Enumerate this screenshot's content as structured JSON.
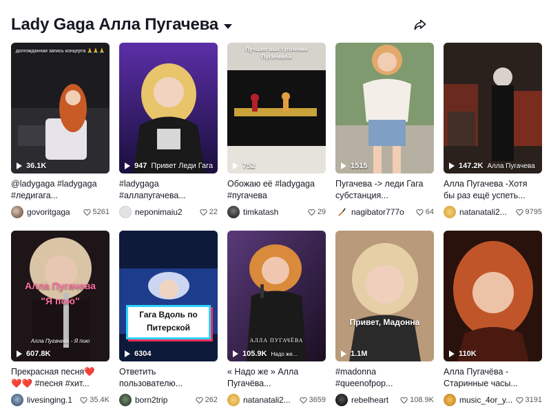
{
  "header": {
    "title": "Lady Gaga Алла Пугачева"
  },
  "videos": [
    {
      "views": "36.1K",
      "overlay": "долгожданная запись концерта 🙏🙏🙏",
      "caption_line1": "@ladygaga #ladygaga",
      "caption_line2": "#ледигага...",
      "author": "govoritgaga",
      "likes": "5261",
      "colors": {
        "bg": "#2b2a2e",
        "accent": "#c85a26"
      }
    },
    {
      "views": "947",
      "overlay": "Привет Леди Гага",
      "caption_line1": "#ladygaga",
      "caption_line2": "#аллапугачева...",
      "author": "neponimaiu2",
      "likes": "22",
      "colors": {
        "bg": "#3a1f7a",
        "accent": "#e8c46a"
      }
    },
    {
      "views": "752",
      "overlay": "Лучшее выступление Пугачевой",
      "caption_line1": "Обожаю её #ladygaga",
      "caption_line2": "#пугачева",
      "author": "timkatash",
      "likes": "29",
      "colors": {
        "bg": "#c9c6bf",
        "accent": "#b3202a"
      }
    },
    {
      "views": "1515",
      "overlay": "",
      "caption_line1": "Пугачева -> леди Гага",
      "caption_line2": "субстанция...",
      "author": "nagibator777o",
      "likes": "64",
      "colors": {
        "bg": "#8aa37a",
        "accent": "#e3a86b"
      }
    },
    {
      "views": "147.2K",
      "overlay": "Алла Пугачева",
      "caption_line1": "Алла Пугачева -Хотя",
      "caption_line2": "бы раз ещё успеть...",
      "author": "natanatali2...",
      "likes": "9795",
      "colors": {
        "bg": "#4a3a33",
        "accent": "#c53a2a"
      }
    },
    {
      "views": "607.8K",
      "overlay": "Алла Пугачева",
      "overlay2": "\"Я пою\"",
      "overlay3": "Алла Пугачева - Я пою",
      "caption_line1": "Прекрасная песня❤️",
      "caption_line2": "❤️❤️ #песня #хит...",
      "author": "livesinging.1",
      "likes": "35.4K",
      "colors": {
        "bg": "#2a1c22",
        "accent": "#ff5a8c"
      }
    },
    {
      "views": "6304",
      "overlay": "Гага Вдоль по Питерской",
      "caption_line1": "Ответить",
      "caption_line2": "пользователю...",
      "author": "born2trip",
      "likes": "262",
      "colors": {
        "bg": "#1f3a8a",
        "accent": "#e9e2ff"
      }
    },
    {
      "views": "105.9K",
      "overlay": "АЛЛА ПУГАЧЁВА",
      "overlay2": "Надо же...",
      "caption_line1": "« Надо же » Алла",
      "caption_line2": "Пугачёва...",
      "author": "natanatali2...",
      "likes": "3659",
      "colors": {
        "bg": "#2a1a35",
        "accent": "#d98a3a"
      }
    },
    {
      "views": "1.1M",
      "overlay": "Привет, Мадонна",
      "caption_line1": "#madonna",
      "caption_line2": "#queenofpop...",
      "author": "rebelheart",
      "likes": "108.9K",
      "colors": {
        "bg": "#c4a684",
        "accent": "#e8cfa5"
      }
    },
    {
      "views": "110K",
      "overlay": "",
      "caption_line1": "Алла Пугачёва -",
      "caption_line2": "Старинные часы...",
      "author": "music_4or_y...",
      "likes": "3191",
      "colors": {
        "bg": "#3a1a12",
        "accent": "#c1552a"
      }
    }
  ]
}
